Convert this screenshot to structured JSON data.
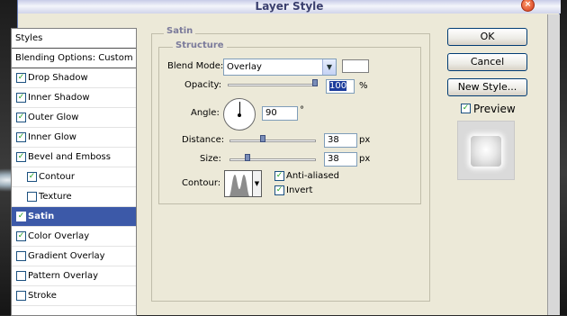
{
  "window": {
    "title": "Layer Style",
    "close_glyph": "×"
  },
  "styles_list": [
    {
      "label": "Styles",
      "checkbox": false,
      "checked": false,
      "selected": false,
      "header": true
    },
    {
      "label": "Blending Options: Custom",
      "checkbox": false,
      "checked": false,
      "selected": false,
      "header": true
    },
    {
      "label": "Drop Shadow",
      "checkbox": true,
      "checked": true,
      "selected": false,
      "indent": false
    },
    {
      "label": "Inner Shadow",
      "checkbox": true,
      "checked": true,
      "selected": false,
      "indent": false
    },
    {
      "label": "Outer Glow",
      "checkbox": true,
      "checked": true,
      "selected": false,
      "indent": false
    },
    {
      "label": "Inner Glow",
      "checkbox": true,
      "checked": true,
      "selected": false,
      "indent": false
    },
    {
      "label": "Bevel and Emboss",
      "checkbox": true,
      "checked": true,
      "selected": false,
      "indent": false
    },
    {
      "label": "Contour",
      "checkbox": true,
      "checked": true,
      "selected": false,
      "indent": true
    },
    {
      "label": "Texture",
      "checkbox": true,
      "checked": false,
      "selected": false,
      "indent": true
    },
    {
      "label": "Satin",
      "checkbox": true,
      "checked": true,
      "selected": true,
      "indent": false
    },
    {
      "label": "Color Overlay",
      "checkbox": true,
      "checked": true,
      "selected": false,
      "indent": false
    },
    {
      "label": "Gradient Overlay",
      "checkbox": true,
      "checked": false,
      "selected": false,
      "indent": false
    },
    {
      "label": "Pattern Overlay",
      "checkbox": true,
      "checked": false,
      "selected": false,
      "indent": false
    },
    {
      "label": "Stroke",
      "checkbox": true,
      "checked": false,
      "selected": false,
      "indent": false
    }
  ],
  "satin": {
    "group_title": "Satin",
    "structure_title": "Structure",
    "blend_mode_label": "Blend Mode:",
    "blend_mode_value": "Overlay",
    "blend_color": "#ffffff",
    "opacity_label": "Opacity:",
    "opacity_value": "100",
    "opacity_unit": "%",
    "opacity_fraction": 1.0,
    "angle_label": "Angle:",
    "angle_value": "90",
    "angle_unit": "°",
    "distance_label": "Distance:",
    "distance_value": "38",
    "distance_unit": "px",
    "distance_fraction": 0.38,
    "size_label": "Size:",
    "size_value": "38",
    "size_unit": "px",
    "size_fraction": 0.19,
    "contour_label": "Contour:",
    "anti_aliased_label": "Anti-aliased",
    "anti_aliased_checked": true,
    "invert_label": "Invert",
    "invert_checked": true
  },
  "buttons": {
    "ok": "OK",
    "cancel": "Cancel",
    "new_style": "New Style..."
  },
  "preview": {
    "label": "Preview",
    "checked": true
  },
  "colors": {
    "selected_row": "#3c59a8",
    "dialog_bg": "#ece9d8",
    "check": "#21a121"
  },
  "icons": {
    "check": "✓",
    "dropdown": "▼"
  }
}
